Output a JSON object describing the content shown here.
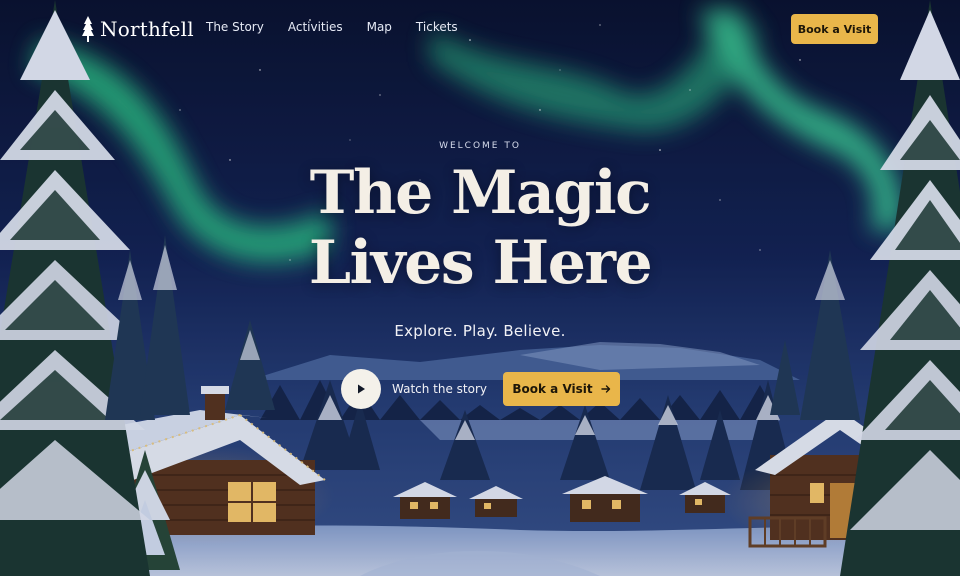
{
  "brand": {
    "name": "Northfell",
    "logo_icon": "pine-tree-icon"
  },
  "nav": {
    "items": [
      {
        "label": "The Story"
      },
      {
        "label": "Activities"
      },
      {
        "label": "Map"
      },
      {
        "label": "Tickets"
      }
    ]
  },
  "header_cta": {
    "label": "Book a Visit"
  },
  "hero": {
    "eyebrow": "WELCOME TO",
    "headline_line1": "The Magic",
    "headline_line2": "Lives Here",
    "subline": "Explore. Play. Believe.",
    "watch_label": "Watch the story",
    "watch_icon": "play-icon",
    "cta_label": "Book a Visit",
    "cta_icon": "arrow-right-icon"
  },
  "colors": {
    "accent": "#e9b64a",
    "sky_top": "#0b1433",
    "aurora": "#3fd89a",
    "headline": "#f4efe6"
  }
}
